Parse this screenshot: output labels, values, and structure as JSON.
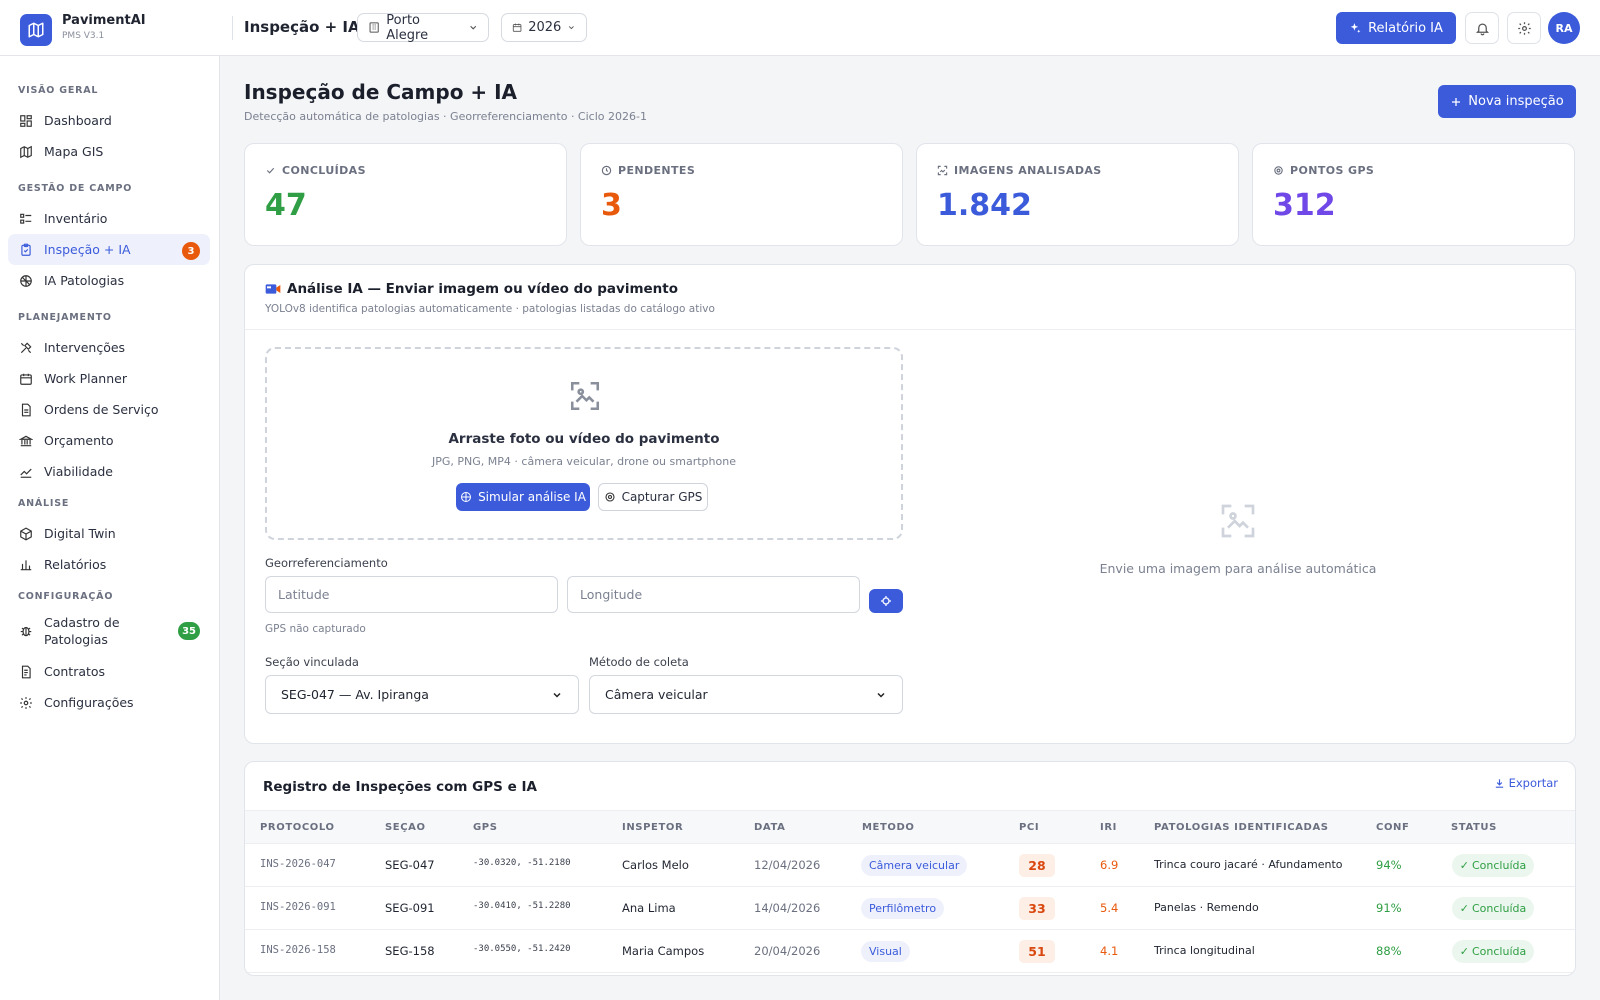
{
  "app": {
    "name": "PavimentAI",
    "version": "PMS V3.1"
  },
  "topbar": {
    "page": "Inspeção + IA",
    "city": "Porto Alegre",
    "year": "2026",
    "report_button": "Relatório IA",
    "avatar_initials": "RA"
  },
  "sidebar": {
    "sections": [
      {
        "title": "VISÃO GERAL",
        "items": [
          {
            "label": "Dashboard",
            "icon": "dashboard-icon"
          },
          {
            "label": "Mapa GIS",
            "icon": "map-icon"
          }
        ]
      },
      {
        "title": "GESTÃO DE CAMPO",
        "items": [
          {
            "label": "Inventário",
            "icon": "list-icon"
          },
          {
            "label": "Inspeção + IA",
            "icon": "clipboard-icon",
            "active": true,
            "badge": "3"
          },
          {
            "label": "IA Patologias",
            "icon": "brain-icon"
          }
        ]
      },
      {
        "title": "PLANEJAMENTO",
        "items": [
          {
            "label": "Intervenções",
            "icon": "tools-icon"
          },
          {
            "label": "Work Planner",
            "icon": "calendar-icon"
          },
          {
            "label": "Ordens de Serviço",
            "icon": "document-icon"
          },
          {
            "label": "Orçamento",
            "icon": "bank-icon"
          },
          {
            "label": "Viabilidade",
            "icon": "trend-icon"
          }
        ]
      },
      {
        "title": "ANÁLISE",
        "items": [
          {
            "label": "Digital Twin",
            "icon": "cube-icon"
          },
          {
            "label": "Relatórios",
            "icon": "bar-chart-icon"
          }
        ]
      },
      {
        "title": "CONFIGURAÇÃO",
        "items": [
          {
            "label": "Cadastro de Patologias",
            "icon": "bug-icon",
            "badge": "35"
          },
          {
            "label": "Contratos",
            "icon": "file-icon"
          },
          {
            "label": "Configurações",
            "icon": "gear-icon"
          }
        ]
      }
    ]
  },
  "page": {
    "title": "Inspeção de Campo + IA",
    "subtitle": "Detecção automática de patologias · Georreferenciamento · Ciclo 2026-1",
    "new_button": "Nova inspeção"
  },
  "kpis": [
    {
      "label": "CONCLUÍDAS",
      "value": "47",
      "color": "#2f9e44",
      "icon": "check-icon"
    },
    {
      "label": "PENDENTES",
      "value": "3",
      "color": "#e8590c",
      "icon": "clock-icon"
    },
    {
      "label": "IMAGENS ANALISADAS",
      "value": "1.842",
      "color": "#3b5bdb",
      "icon": "image-scan-icon"
    },
    {
      "label": "PONTOS GPS",
      "value": "312",
      "color": "#7048e8",
      "icon": "target-icon"
    }
  ],
  "ai": {
    "title": "Análise IA — Enviar imagem ou vídeo do pavimento",
    "subtitle": "YOLOv8 identifica patologias automaticamente · patologias listadas do catálogo ativo",
    "dropzone_title": "Arraste foto ou vídeo do pavimento",
    "dropzone_sub": "JPG, PNG, MP4 · câmera veicular, drone ou smartphone",
    "simulate_button": "Simular análise IA",
    "gps_button": "Capturar GPS",
    "geo_label": "Georreferenciamento",
    "lat_placeholder": "Latitude",
    "lng_placeholder": "Longitude",
    "gps_status": "GPS não capturado",
    "section_label": "Seção vinculada",
    "section_value": "SEG-047 — Av. Ipiranga",
    "method_label": "Método de coleta",
    "method_value": "Câmera veicular",
    "empty_text": "Envie uma imagem para análise automática"
  },
  "table": {
    "title": "Registro de Inspeções com GPS e IA",
    "export": "Exportar",
    "columns": [
      "PROTOCOLO",
      "SEÇÃO",
      "GPS",
      "INSPETOR",
      "DATA",
      "MÉTODO",
      "PCI",
      "IRI",
      "PATOLOGIAS IDENTIFICADAS",
      "CONF.",
      "STATUS"
    ],
    "rows": [
      {
        "protocol": "INS-2026-047",
        "section": "SEG-047",
        "gps": "-30.0320, -51.2180",
        "inspector": "Carlos Melo",
        "date": "12/04/2026",
        "method": "Câmera veicular",
        "pci": "28",
        "iri": "6.9",
        "pathologies": "Trinca couro jacaré · Afundamento",
        "conf": "94%",
        "status": "Concluída"
      },
      {
        "protocol": "INS-2026-091",
        "section": "SEG-091",
        "gps": "-30.0410, -51.2280",
        "inspector": "Ana Lima",
        "date": "14/04/2026",
        "method": "Perfilômetro",
        "pci": "33",
        "iri": "5.4",
        "pathologies": "Panelas · Remendo",
        "conf": "91%",
        "status": "Concluída"
      },
      {
        "protocol": "INS-2026-158",
        "section": "SEG-158",
        "gps": "-30.0550, -51.2420",
        "inspector": "Maria Campos",
        "date": "20/04/2026",
        "method": "Visual",
        "pci": "51",
        "iri": "4.1",
        "pathologies": "Trinca longitudinal",
        "conf": "88%",
        "status": "Concluída"
      }
    ]
  },
  "colors": {
    "accent": "#3b5bdb",
    "badge_red": "#e8590c",
    "badge_green": "#2f9e44"
  }
}
